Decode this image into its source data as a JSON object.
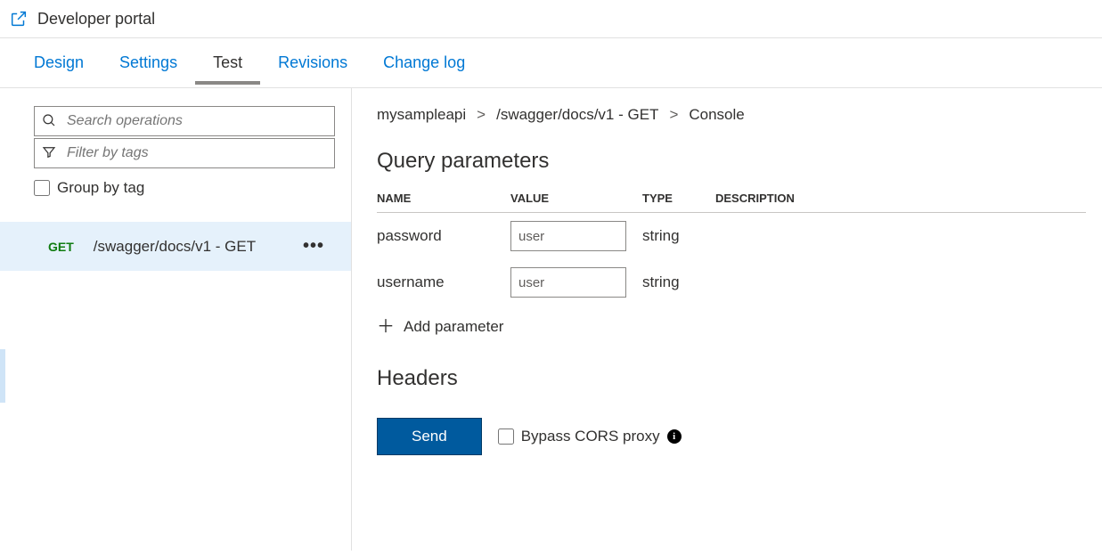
{
  "topbar": {
    "developer_portal": "Developer portal"
  },
  "tabs": {
    "design": "Design",
    "settings": "Settings",
    "test": "Test",
    "revisions": "Revisions",
    "changelog": "Change log",
    "active": "test"
  },
  "left": {
    "search_placeholder": "Search operations",
    "filter_placeholder": "Filter by tags",
    "group_by_tag": "Group by tag",
    "operations": [
      {
        "verb": "GET",
        "path": "/swagger/docs/v1 - GET"
      }
    ]
  },
  "breadcrumb": {
    "api": "mysampleapi",
    "op": "/swagger/docs/v1 - GET",
    "page": "Console"
  },
  "params": {
    "title": "Query parameters",
    "headers": {
      "name": "NAME",
      "value": "VALUE",
      "type": "TYPE",
      "description": "DESCRIPTION"
    },
    "rows": [
      {
        "name": "password",
        "value": "user",
        "type": "string",
        "description": ""
      },
      {
        "name": "username",
        "value": "user",
        "type": "string",
        "description": ""
      }
    ],
    "add_label": "Add parameter"
  },
  "headers_section": {
    "title": "Headers"
  },
  "send_bar": {
    "send": "Send",
    "bypass": "Bypass CORS proxy"
  }
}
